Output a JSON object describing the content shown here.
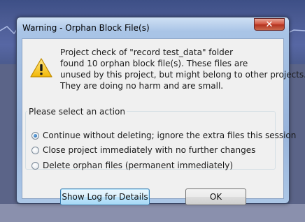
{
  "dialog": {
    "title": "Warning - Orphan Block File(s)",
    "close_glyph": "✕",
    "icon": "warning-icon",
    "message_lines": [
      "Project check of \"record test_data\" folder",
      "found 10 orphan block file(s). These files are",
      "unused by this project, but might belong to other projects.",
      "They are doing no harm and are small."
    ],
    "group_title": "Please select an action",
    "options": [
      {
        "label": "Continue without deleting; ignore the extra files this session",
        "checked": true
      },
      {
        "label": "Close project immediately with no further changes",
        "checked": false
      },
      {
        "label": "Delete orphan files (permanent immediately)",
        "checked": false
      }
    ],
    "buttons": {
      "show_log": "Show Log for Details",
      "ok": "OK"
    }
  }
}
